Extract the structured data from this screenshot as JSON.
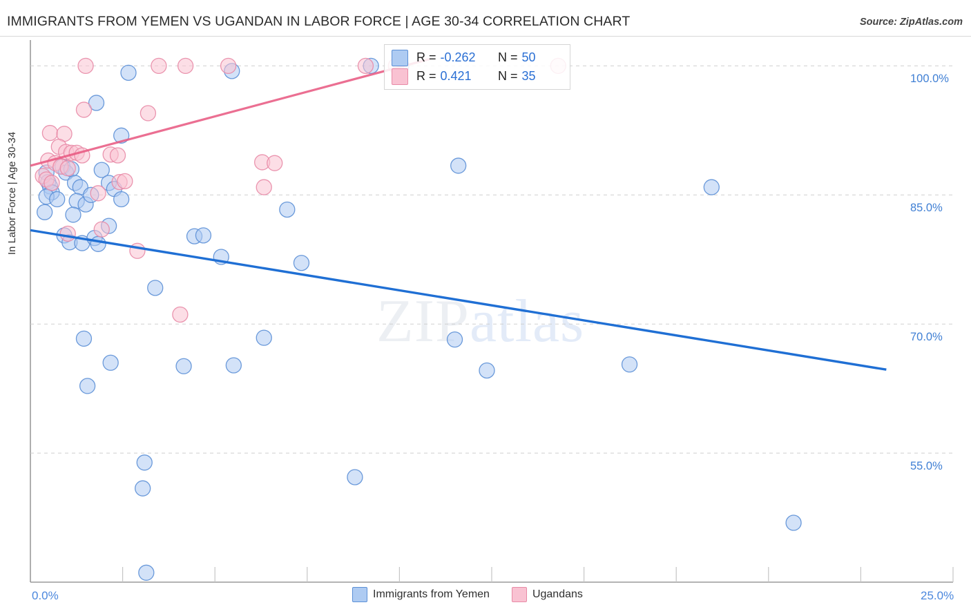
{
  "header": {
    "title": "IMMIGRANTS FROM YEMEN VS UGANDAN IN LABOR FORCE | AGE 30-34 CORRELATION CHART",
    "source": "Source: ZipAtlas.com"
  },
  "watermark": {
    "part1": "ZIP",
    "part2": "atlas"
  },
  "stats": {
    "blue": {
      "r_key": "R =",
      "r_value": "-0.262",
      "n_key": "N =",
      "n_value": "50",
      "color": "#aecbf2"
    },
    "pink": {
      "r_key": "R =",
      "r_value": "0.421",
      "n_key": "N =",
      "n_value": "35",
      "color": "#f9c2d2"
    }
  },
  "legend": {
    "items": [
      {
        "label": "Immigrants from Yemen",
        "color": "#aecbf2"
      },
      {
        "label": "Ugandans",
        "color": "#f9c2d2"
      }
    ]
  },
  "chart_data": {
    "type": "scatter",
    "title": "IMMIGRANTS FROM YEMEN VS UGANDAN IN LABOR FORCE | AGE 30-34 CORRELATION CHART",
    "xlabel": "",
    "ylabel": "In Labor Force | Age 30-34",
    "xlim": [
      0.0,
      25.0
    ],
    "ylim": [
      40.0,
      103.0
    ],
    "xticklabels": [
      "0.0%",
      "25.0%"
    ],
    "yticklabels": [
      "100.0%",
      "85.0%",
      "70.0%",
      "55.0%"
    ],
    "ytickvalues": [
      100.0,
      85.0,
      70.0,
      55.0
    ],
    "grid": true,
    "legend_position": "bottom-center",
    "series": [
      {
        "name": "Immigrants from Yemen",
        "color": "#aecbf2",
        "edge": "#5b8fd6",
        "r": -0.262,
        "n": 50,
        "trendline": {
          "x0": 0.0,
          "y0": 80.9,
          "x1": 24.0,
          "y1": 64.7
        },
        "points": [
          [
            2.75,
            99.2
          ],
          [
            5.65,
            99.4
          ],
          [
            9.55,
            100.0
          ],
          [
            10.4,
            100.0
          ],
          [
            1.85,
            95.7
          ],
          [
            2.55,
            91.9
          ],
          [
            12.0,
            88.4
          ],
          [
            19.1,
            85.9
          ],
          [
            0.45,
            87.6
          ],
          [
            0.5,
            86.5
          ],
          [
            0.55,
            86.0
          ],
          [
            0.6,
            85.3
          ],
          [
            0.9,
            88.3
          ],
          [
            1.0,
            87.6
          ],
          [
            1.15,
            88.0
          ],
          [
            1.25,
            86.4
          ],
          [
            1.4,
            85.9
          ],
          [
            2.0,
            87.9
          ],
          [
            2.2,
            86.4
          ],
          [
            2.35,
            85.7
          ],
          [
            0.45,
            84.8
          ],
          [
            0.75,
            84.5
          ],
          [
            1.3,
            84.3
          ],
          [
            1.55,
            83.9
          ],
          [
            1.7,
            85.0
          ],
          [
            2.55,
            84.5
          ],
          [
            7.2,
            83.3
          ],
          [
            0.4,
            83.0
          ],
          [
            1.2,
            82.7
          ],
          [
            2.2,
            81.4
          ],
          [
            0.95,
            80.3
          ],
          [
            1.1,
            79.5
          ],
          [
            1.45,
            79.4
          ],
          [
            1.8,
            80.0
          ],
          [
            1.9,
            79.3
          ],
          [
            4.6,
            80.2
          ],
          [
            4.85,
            80.3
          ],
          [
            5.35,
            77.8
          ],
          [
            7.6,
            77.1
          ],
          [
            3.5,
            74.2
          ],
          [
            1.5,
            68.3
          ],
          [
            6.55,
            68.4
          ],
          [
            11.9,
            68.2
          ],
          [
            2.25,
            65.5
          ],
          [
            4.3,
            65.1
          ],
          [
            5.7,
            65.2
          ],
          [
            12.8,
            64.6
          ],
          [
            16.8,
            65.3
          ],
          [
            1.6,
            62.8
          ],
          [
            3.2,
            53.9
          ],
          [
            3.15,
            50.9
          ],
          [
            9.1,
            52.2
          ],
          [
            21.4,
            46.9
          ],
          [
            3.25,
            41.1
          ]
        ]
      },
      {
        "name": "Ugandans",
        "color": "#f9c2d2",
        "edge": "#e88aa6",
        "r": 0.421,
        "n": 35,
        "trendline": {
          "x0": 0.0,
          "y0": 88.4,
          "x1": 11.2,
          "y1": 100.8
        },
        "points": [
          [
            1.55,
            100.0
          ],
          [
            3.6,
            100.0
          ],
          [
            4.35,
            100.0
          ],
          [
            5.55,
            100.0
          ],
          [
            9.4,
            100.0
          ],
          [
            10.25,
            100.0
          ],
          [
            14.8,
            100.0
          ],
          [
            1.5,
            94.9
          ],
          [
            3.3,
            94.5
          ],
          [
            0.55,
            92.2
          ],
          [
            0.95,
            92.1
          ],
          [
            0.8,
            90.6
          ],
          [
            1.0,
            90.0
          ],
          [
            1.15,
            89.9
          ],
          [
            1.3,
            89.9
          ],
          [
            1.45,
            89.6
          ],
          [
            2.25,
            89.7
          ],
          [
            2.45,
            89.6
          ],
          [
            0.5,
            89.0
          ],
          [
            0.7,
            88.7
          ],
          [
            0.85,
            88.3
          ],
          [
            1.05,
            88.1
          ],
          [
            6.5,
            88.8
          ],
          [
            6.85,
            88.7
          ],
          [
            0.35,
            87.2
          ],
          [
            0.45,
            86.8
          ],
          [
            0.6,
            86.4
          ],
          [
            2.5,
            86.5
          ],
          [
            2.65,
            86.6
          ],
          [
            6.55,
            85.9
          ],
          [
            1.9,
            85.2
          ],
          [
            2.0,
            81.0
          ],
          [
            1.05,
            80.5
          ],
          [
            3.0,
            78.5
          ],
          [
            4.2,
            71.1
          ]
        ]
      }
    ]
  }
}
